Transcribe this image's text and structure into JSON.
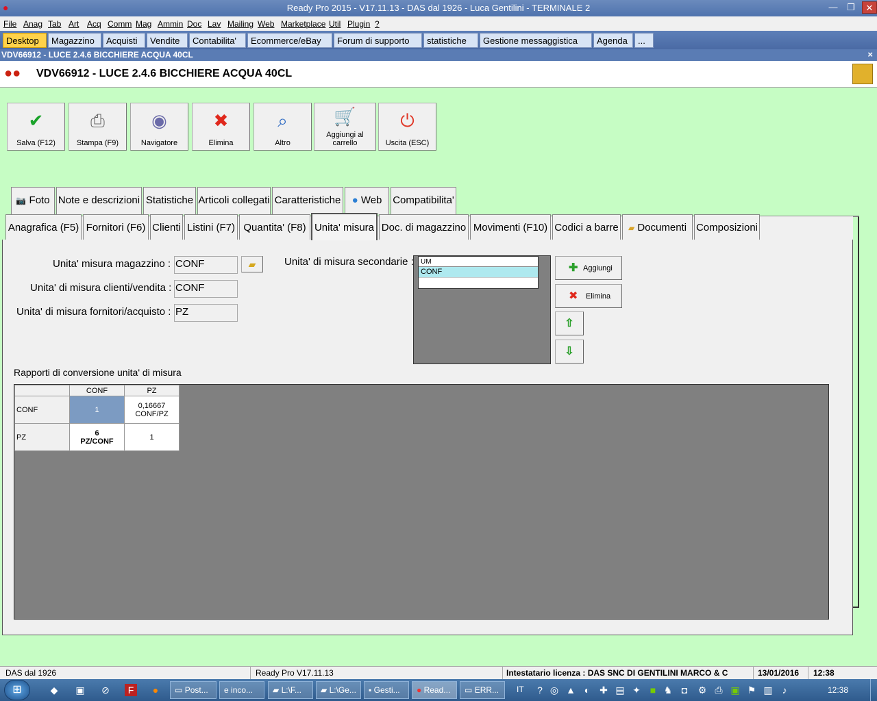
{
  "window": {
    "title": "Ready Pro 2015 - V17.11.13 - DAS dal 1926 - Luca Gentilini - TERMINALE 2",
    "btn_minimize": "—",
    "btn_restore": "❐",
    "btn_close": "✕"
  },
  "menu": [
    "File",
    "Anag",
    "Tab",
    "Art",
    "Acq",
    "Comm",
    "Mag",
    "Ammin",
    "Doc",
    "Lav",
    "Mailing",
    "Web",
    "Marketplace",
    "Util",
    "Plugin",
    "?"
  ],
  "module_tabs": [
    "Desktop",
    "Magazzino",
    "Acquisti",
    "Vendite",
    "Contabilita'",
    "Ecommerce/eBay",
    "Forum di supporto",
    "statistiche",
    "Gestione messaggistica",
    "Agenda",
    "..."
  ],
  "doc_bar": {
    "title": "VDV66912 - LUCE 2.4.6 BICCHIERE ACQUA 40CL",
    "close": "×"
  },
  "header": {
    "title": "VDV66912 - LUCE 2.4.6 BICCHIERE ACQUA 40CL"
  },
  "toolbar": {
    "save": "Salva (F12)",
    "print": "Stampa (F9)",
    "navigator": "Navigatore",
    "delete": "Elimina",
    "other": "Altro",
    "add_cart": "Aggiungi al carrello",
    "exit": "Uscita (ESC)"
  },
  "tabs_row1": [
    "Foto",
    "Note e descrizioni",
    "Statistiche",
    "Articoli collegati",
    "Caratteristiche",
    "Web",
    "Compatibilita'"
  ],
  "tabs_row2": [
    "Anagrafica (F5)",
    "Fornitori (F6)",
    "Clienti",
    "Listini (F7)",
    "Quantita' (F8)",
    "Unita' misura",
    "Doc. di magazzino",
    "Movimenti (F10)",
    "Codici a barre",
    "Documenti",
    "Composizioni"
  ],
  "form": {
    "um_magazzino_label": "Unita' misura magazzino :",
    "um_magazzino_value": "CONF",
    "um_clienti_label": "Unita' di misura clienti/vendita :",
    "um_clienti_value": "CONF",
    "um_fornitori_label": "Unita' di misura fornitori/acquisto :",
    "um_fornitori_value": "PZ",
    "um_secondarie_label": "Unita' di misura secondarie :"
  },
  "secondary_um": {
    "header": "UM",
    "rows": [
      "CONF"
    ]
  },
  "side_buttons": {
    "add": "Aggiungi",
    "remove": "Elimina"
  },
  "conversion": {
    "label": "Rapporti di conversione unita' di misura",
    "columns": [
      "CONF",
      "PZ"
    ],
    "rows": [
      {
        "name": "CONF",
        "cells": [
          "1",
          "0,16667 CONF/PZ"
        ]
      },
      {
        "name": "PZ",
        "cells": [
          "6 PZ/CONF",
          "1"
        ]
      }
    ]
  },
  "statusbar": {
    "company": "DAS dal 1926",
    "version": "Ready Pro V17.11.13",
    "license": "Intestatario licenza : DAS SNC DI GENTILINI MARCO & C",
    "date": "13/01/2016",
    "time": "12:38"
  },
  "taskbar": {
    "tasks": [
      "Post...",
      "inco...",
      "L:\\F...",
      "L:\\Ge...",
      "Gesti...",
      "Read...",
      "ERR..."
    ],
    "lang": "IT",
    "clock": "12:38"
  }
}
